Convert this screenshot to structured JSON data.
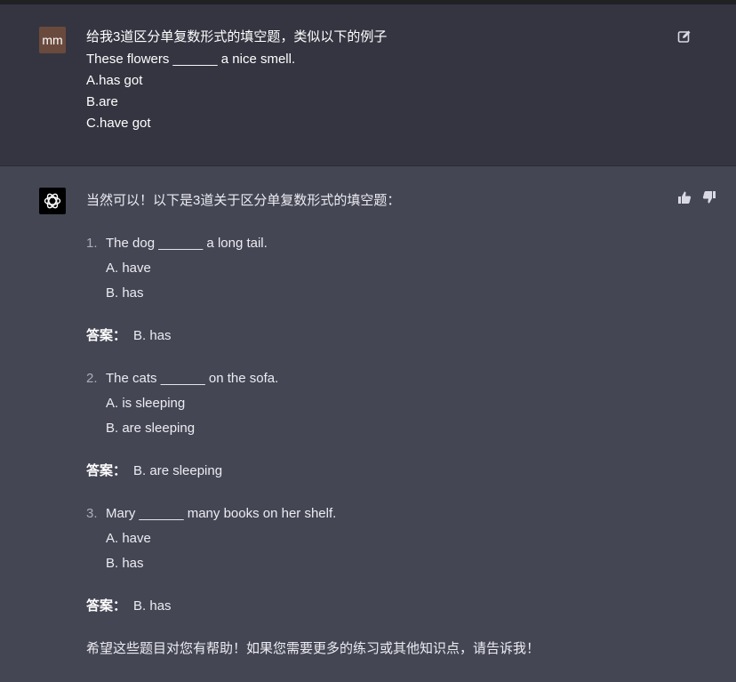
{
  "user_message": {
    "avatar_initials": "mm",
    "lines": [
      "给我3道区分单复数形式的填空题，类似以下的例子",
      "These flowers ______ a nice smell.",
      "A.has got",
      "B.are",
      "C.have got"
    ]
  },
  "assistant_message": {
    "intro": "当然可以！以下是3道关于区分单复数形式的填空题：",
    "questions": [
      {
        "number": "1.",
        "text": "The dog ______ a long tail.",
        "options": [
          "A. have",
          "B. has"
        ],
        "answer_label": "答案：",
        "answer": "B. has"
      },
      {
        "number": "2.",
        "text": "The cats ______ on the sofa.",
        "options": [
          "A. is sleeping",
          "B. are sleeping"
        ],
        "answer_label": "答案：",
        "answer": "B. are sleeping"
      },
      {
        "number": "3.",
        "text": "Mary ______ many books on her shelf.",
        "options": [
          "A. have",
          "B. has"
        ],
        "answer_label": "答案：",
        "answer": "B. has"
      }
    ],
    "closing": "希望这些题目对您有帮助！如果您需要更多的练习或其他知识点，请告诉我！"
  },
  "colors": {
    "user_bg": "#343541",
    "assistant_bg": "#444654",
    "avatar_user_bg": "#6b4a3e",
    "text": "#ececf1"
  },
  "icons": [
    "edit-icon",
    "thumbs-up-icon",
    "thumbs-down-icon",
    "openai-logo-icon"
  ]
}
